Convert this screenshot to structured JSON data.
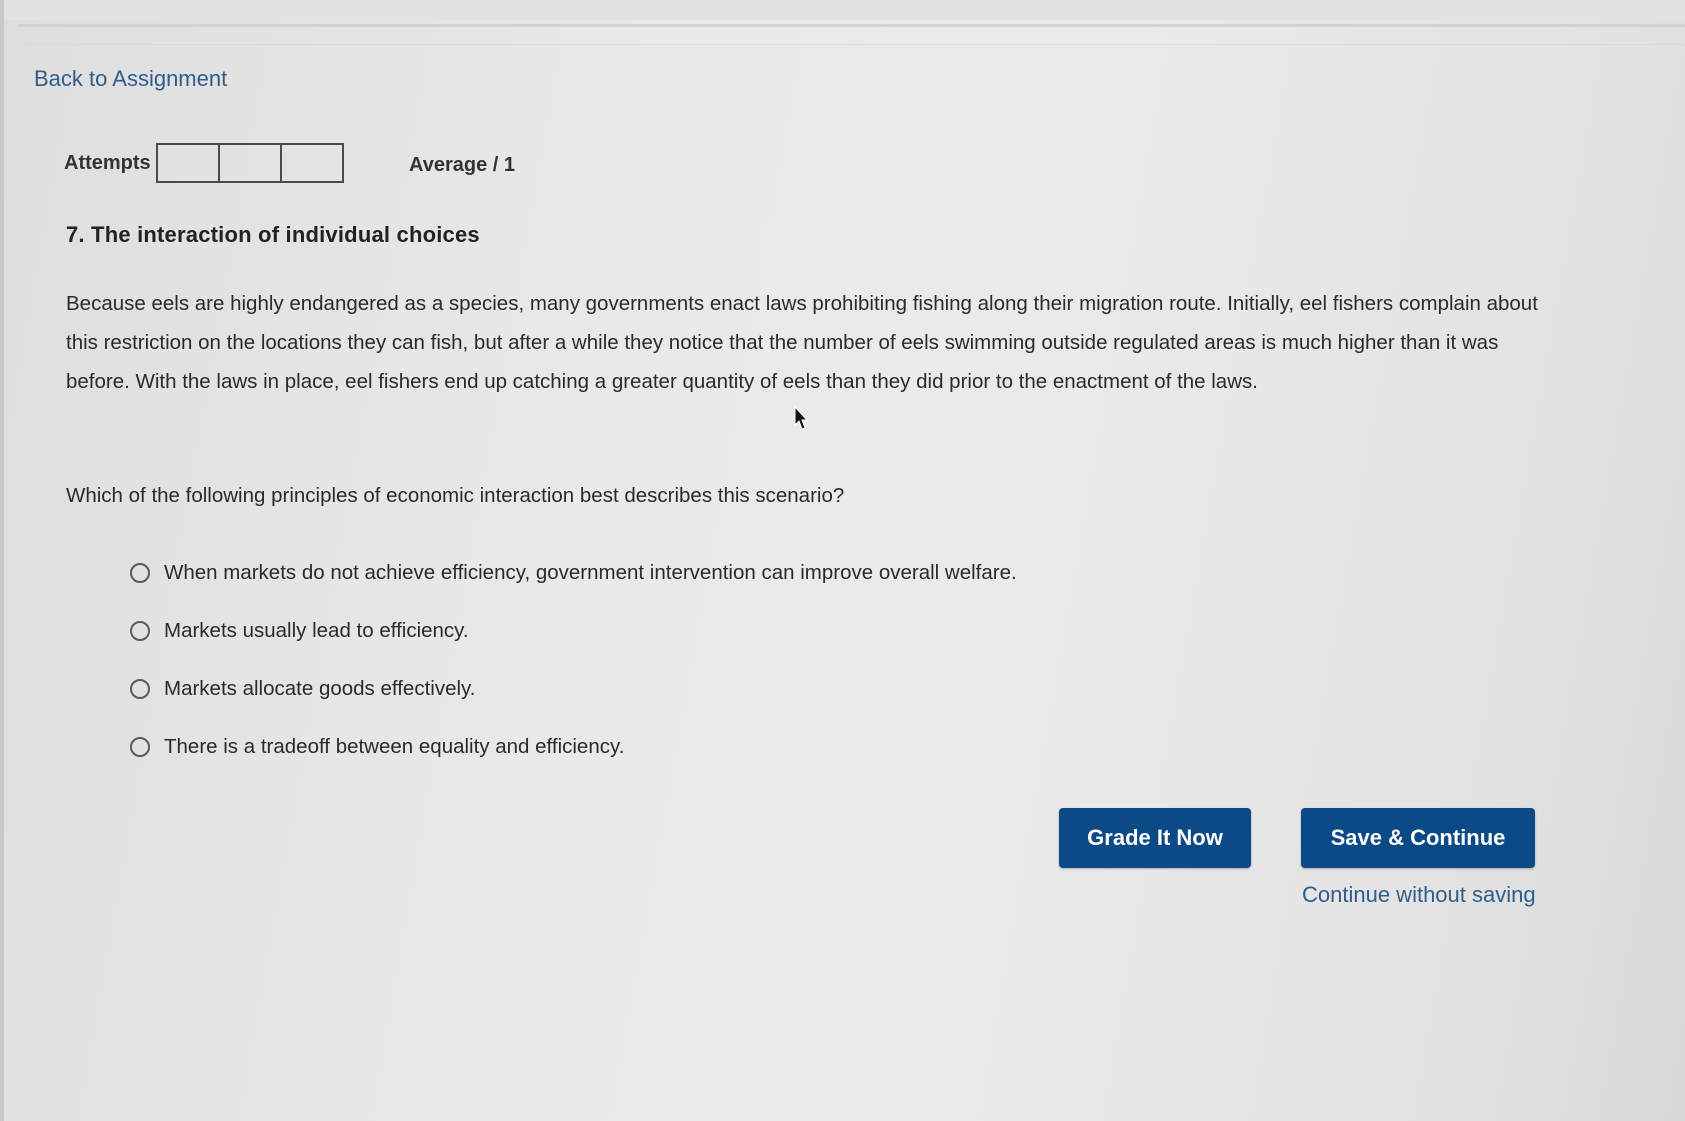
{
  "nav": {
    "back_label": "Back to Assignment"
  },
  "attempts": {
    "label": "Attempts",
    "box_count": 3,
    "average_label": "Average / 1"
  },
  "question": {
    "title": "7. The interaction of individual choices",
    "scenario": "Because eels are highly endangered as a species, many governments enact laws prohibiting fishing along their migration route. Initially, eel fishers complain about this restriction on the locations they can fish, but after a while they notice that the number of eels swimming outside regulated areas is much higher than it was before. With the laws in place, eel fishers end up catching a greater quantity of eels than they did prior to the enactment of the laws.",
    "prompt": "Which of the following principles of economic interaction best describes this scenario?",
    "options": [
      "When markets do not achieve efficiency, government intervention can improve overall welfare.",
      "Markets usually lead to efficiency.",
      "Markets allocate goods effectively.",
      "There is a tradeoff between equality and efficiency."
    ]
  },
  "actions": {
    "grade_label": "Grade It Now",
    "save_label": "Save & Continue",
    "continue_label": "Continue without saving"
  },
  "colors": {
    "button_bg": "#0b4a86",
    "link": "#2f5d8a"
  }
}
